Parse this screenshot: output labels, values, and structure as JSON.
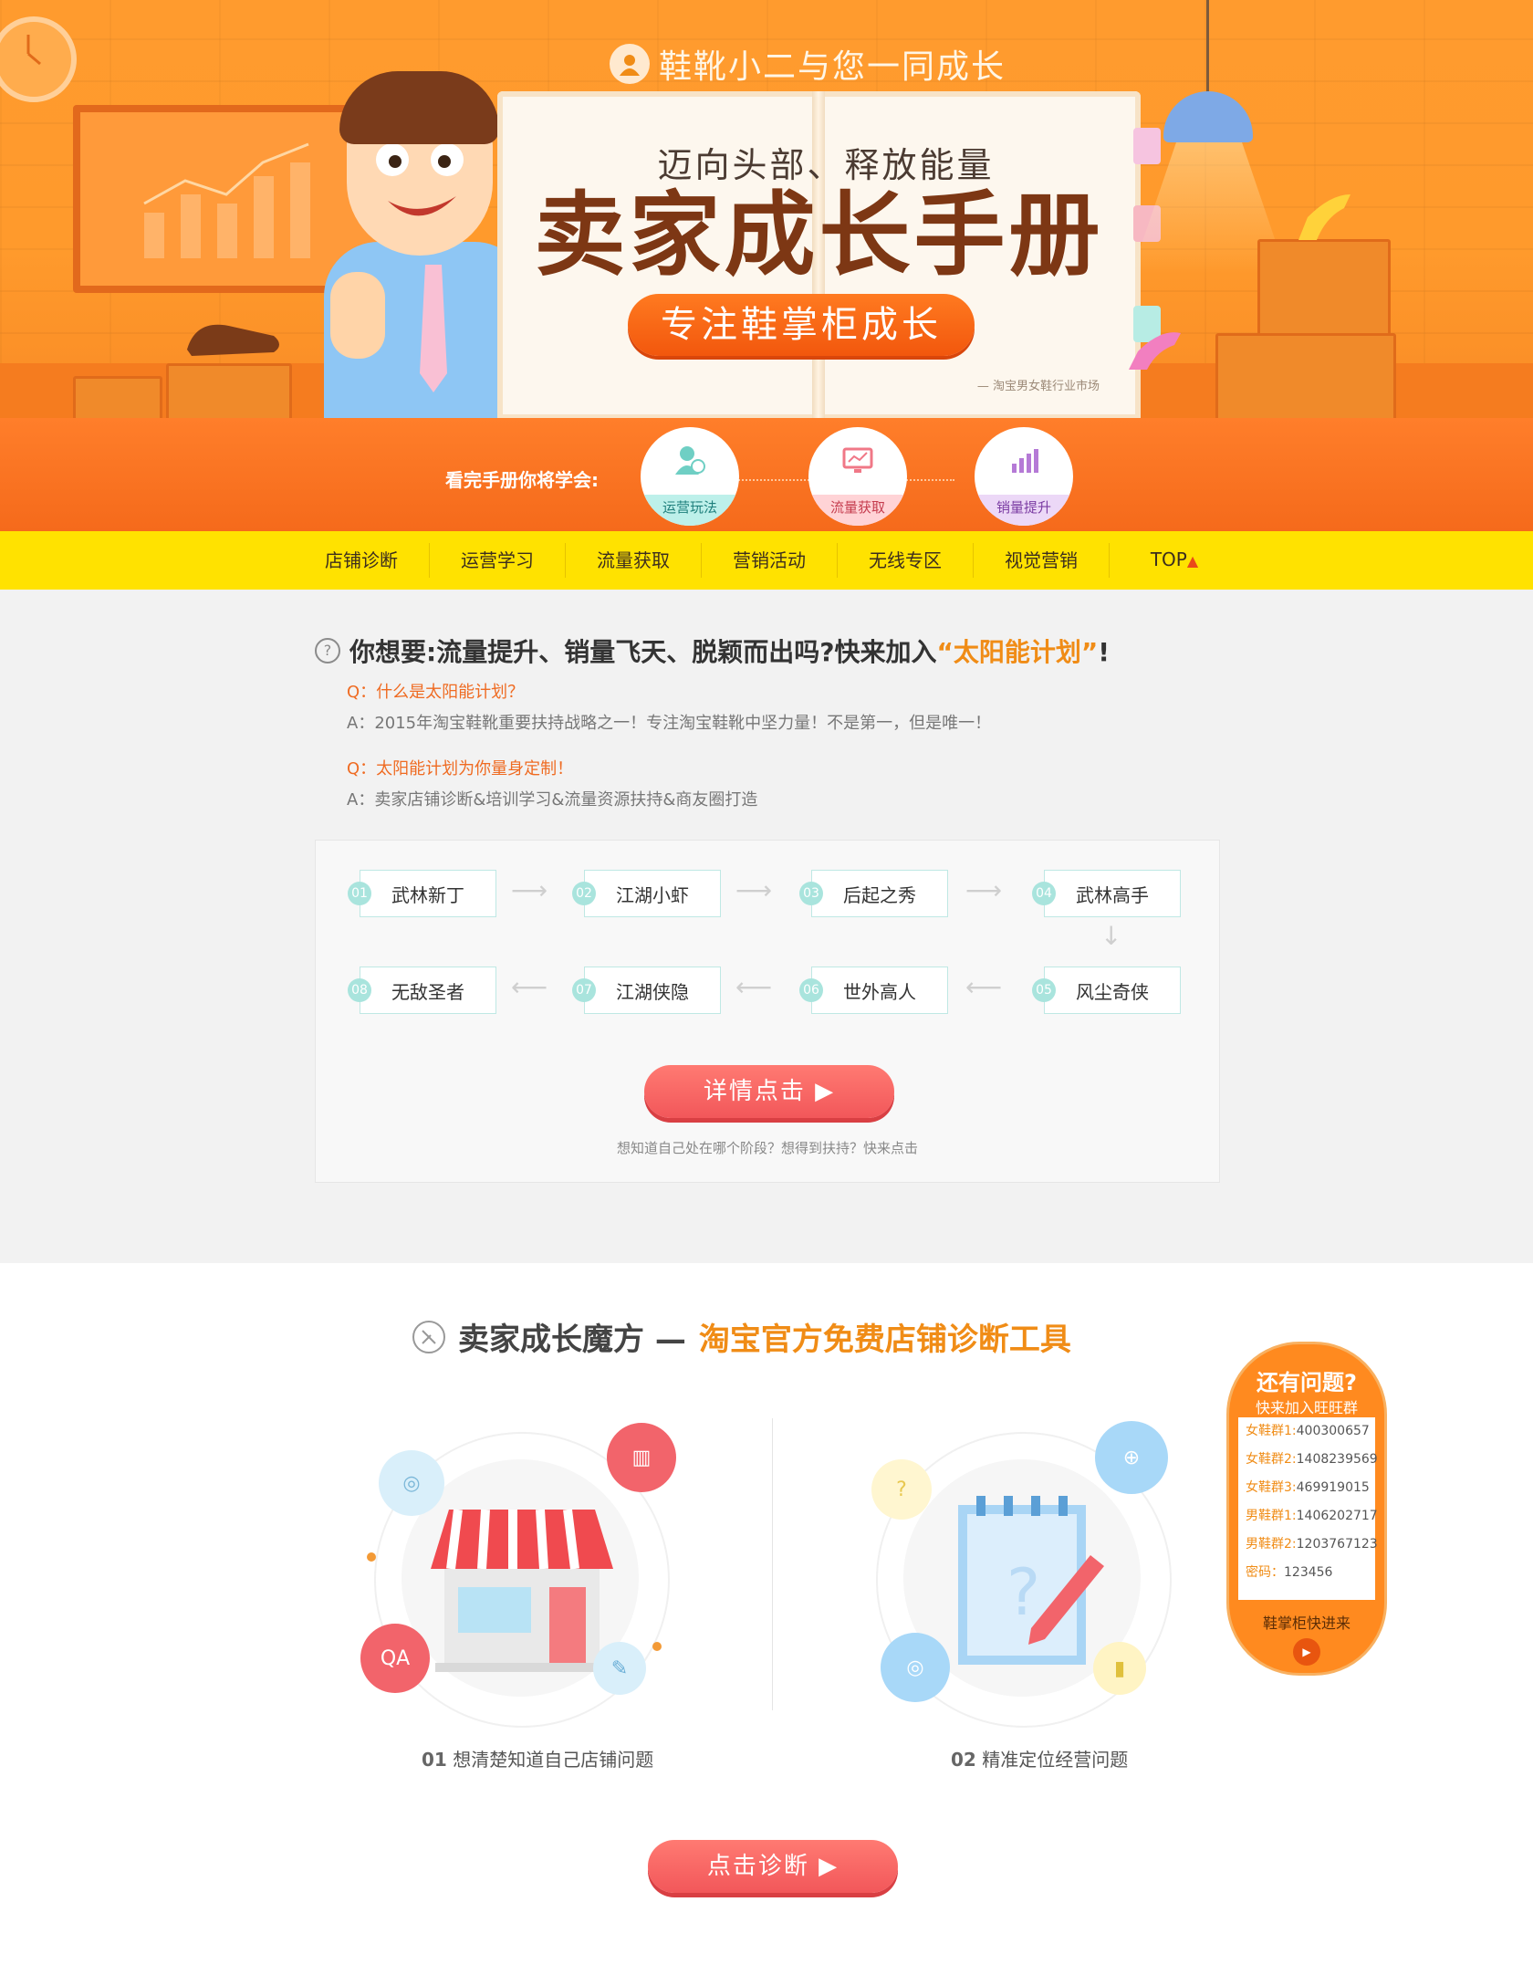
{
  "hero": {
    "top_title": "鞋靴小二与您一同成长",
    "book_subtitle": "迈向头部、释放能量",
    "book_title": "卖家成长手册",
    "book_pill": "专注鞋掌柜成长",
    "book_note": "— 淘宝男女鞋行业市场"
  },
  "learn": {
    "label": "看完手册你将学会:",
    "badges": [
      {
        "label": "运营玩法",
        "icon": "operation-icon"
      },
      {
        "label": "流量获取",
        "icon": "traffic-icon"
      },
      {
        "label": "销量提升",
        "icon": "sales-chart-icon"
      }
    ]
  },
  "nav": {
    "items": [
      "店铺诊断",
      "运营学习",
      "流量获取",
      "营销活动",
      "无线专区",
      "视觉营销"
    ],
    "top_label": "TOP",
    "top_arrow": "▲"
  },
  "sun": {
    "heading_prefix": "你想要:流量提升、销量飞天、脱颖而出吗?快来加入",
    "heading_highlight": "“太阳能计划”",
    "heading_suffix": "!",
    "q1": "Q：什么是太阳能计划？",
    "a1": "A：2015年淘宝鞋靴重要扶持战略之一！专注淘宝鞋靴中坚力量！不是第一，但是唯一！",
    "q2": "Q：太阳能计划为你量身定制！",
    "a2": "A：卖家店铺诊断&培训学习&流量资源扶持&商友圈打造",
    "levels": [
      {
        "num": "01",
        "label": "武林新丁"
      },
      {
        "num": "02",
        "label": "江湖小虾"
      },
      {
        "num": "03",
        "label": "后起之秀"
      },
      {
        "num": "04",
        "label": "武林高手"
      },
      {
        "num": "05",
        "label": "风尘奇侠"
      },
      {
        "num": "06",
        "label": "世外高人"
      },
      {
        "num": "07",
        "label": "江湖侠隐"
      },
      {
        "num": "08",
        "label": "无敌圣者"
      }
    ],
    "cta_label": "详情点击 ▶",
    "cta_hint": "想知道自己处在哪个阶段？想得到扶持？快来点击"
  },
  "cube": {
    "heading_prefix": "卖家成长魔方 —",
    "heading_highlight": "淘宝官方免费店铺诊断工具",
    "step1_num": "01",
    "step1_text": "想清楚知道自己店铺问题",
    "step2_num": "02",
    "step2_text": "精准定位经营问题",
    "cta_label": "点击诊断 ▶"
  },
  "sidebar": {
    "title": "还有问题?",
    "subtitle": "快来加入旺旺群",
    "groups": [
      {
        "key": "女鞋群1:",
        "value": "400300657"
      },
      {
        "key": "女鞋群2:",
        "value": "1408239569"
      },
      {
        "key": "女鞋群3:",
        "value": "469919015"
      },
      {
        "key": "男鞋群1:",
        "value": "1406202717"
      },
      {
        "key": "男鞋群2:",
        "value": "1203767123"
      },
      {
        "key": "密码：",
        "value": "123456"
      }
    ],
    "footer": "鞋掌柜快进来"
  },
  "colors": {
    "orange": "#ff9a2c",
    "deep_orange": "#f56a1b",
    "yellow": "#ffe200",
    "coral": "#f2575a",
    "teal": "#a9e4dd"
  }
}
